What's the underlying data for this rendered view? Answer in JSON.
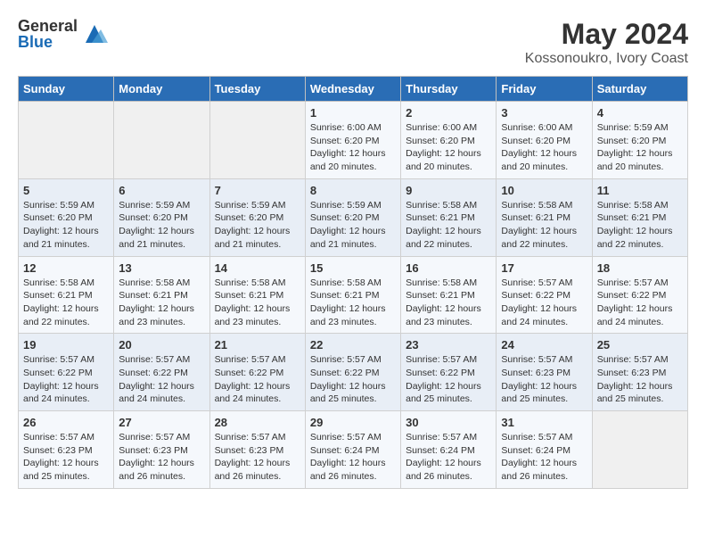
{
  "logo": {
    "general": "General",
    "blue": "Blue"
  },
  "title": "May 2024",
  "subtitle": "Kossonoukro, Ivory Coast",
  "days": [
    "Sunday",
    "Monday",
    "Tuesday",
    "Wednesday",
    "Thursday",
    "Friday",
    "Saturday"
  ],
  "weeks": [
    [
      {
        "day": "",
        "content": ""
      },
      {
        "day": "",
        "content": ""
      },
      {
        "day": "",
        "content": ""
      },
      {
        "day": "1",
        "content": "Sunrise: 6:00 AM\nSunset: 6:20 PM\nDaylight: 12 hours\nand 20 minutes."
      },
      {
        "day": "2",
        "content": "Sunrise: 6:00 AM\nSunset: 6:20 PM\nDaylight: 12 hours\nand 20 minutes."
      },
      {
        "day": "3",
        "content": "Sunrise: 6:00 AM\nSunset: 6:20 PM\nDaylight: 12 hours\nand 20 minutes."
      },
      {
        "day": "4",
        "content": "Sunrise: 5:59 AM\nSunset: 6:20 PM\nDaylight: 12 hours\nand 20 minutes."
      }
    ],
    [
      {
        "day": "5",
        "content": "Sunrise: 5:59 AM\nSunset: 6:20 PM\nDaylight: 12 hours\nand 21 minutes."
      },
      {
        "day": "6",
        "content": "Sunrise: 5:59 AM\nSunset: 6:20 PM\nDaylight: 12 hours\nand 21 minutes."
      },
      {
        "day": "7",
        "content": "Sunrise: 5:59 AM\nSunset: 6:20 PM\nDaylight: 12 hours\nand 21 minutes."
      },
      {
        "day": "8",
        "content": "Sunrise: 5:59 AM\nSunset: 6:20 PM\nDaylight: 12 hours\nand 21 minutes."
      },
      {
        "day": "9",
        "content": "Sunrise: 5:58 AM\nSunset: 6:21 PM\nDaylight: 12 hours\nand 22 minutes."
      },
      {
        "day": "10",
        "content": "Sunrise: 5:58 AM\nSunset: 6:21 PM\nDaylight: 12 hours\nand 22 minutes."
      },
      {
        "day": "11",
        "content": "Sunrise: 5:58 AM\nSunset: 6:21 PM\nDaylight: 12 hours\nand 22 minutes."
      }
    ],
    [
      {
        "day": "12",
        "content": "Sunrise: 5:58 AM\nSunset: 6:21 PM\nDaylight: 12 hours\nand 22 minutes."
      },
      {
        "day": "13",
        "content": "Sunrise: 5:58 AM\nSunset: 6:21 PM\nDaylight: 12 hours\nand 23 minutes."
      },
      {
        "day": "14",
        "content": "Sunrise: 5:58 AM\nSunset: 6:21 PM\nDaylight: 12 hours\nand 23 minutes."
      },
      {
        "day": "15",
        "content": "Sunrise: 5:58 AM\nSunset: 6:21 PM\nDaylight: 12 hours\nand 23 minutes."
      },
      {
        "day": "16",
        "content": "Sunrise: 5:58 AM\nSunset: 6:21 PM\nDaylight: 12 hours\nand 23 minutes."
      },
      {
        "day": "17",
        "content": "Sunrise: 5:57 AM\nSunset: 6:22 PM\nDaylight: 12 hours\nand 24 minutes."
      },
      {
        "day": "18",
        "content": "Sunrise: 5:57 AM\nSunset: 6:22 PM\nDaylight: 12 hours\nand 24 minutes."
      }
    ],
    [
      {
        "day": "19",
        "content": "Sunrise: 5:57 AM\nSunset: 6:22 PM\nDaylight: 12 hours\nand 24 minutes."
      },
      {
        "day": "20",
        "content": "Sunrise: 5:57 AM\nSunset: 6:22 PM\nDaylight: 12 hours\nand 24 minutes."
      },
      {
        "day": "21",
        "content": "Sunrise: 5:57 AM\nSunset: 6:22 PM\nDaylight: 12 hours\nand 24 minutes."
      },
      {
        "day": "22",
        "content": "Sunrise: 5:57 AM\nSunset: 6:22 PM\nDaylight: 12 hours\nand 25 minutes."
      },
      {
        "day": "23",
        "content": "Sunrise: 5:57 AM\nSunset: 6:22 PM\nDaylight: 12 hours\nand 25 minutes."
      },
      {
        "day": "24",
        "content": "Sunrise: 5:57 AM\nSunset: 6:23 PM\nDaylight: 12 hours\nand 25 minutes."
      },
      {
        "day": "25",
        "content": "Sunrise: 5:57 AM\nSunset: 6:23 PM\nDaylight: 12 hours\nand 25 minutes."
      }
    ],
    [
      {
        "day": "26",
        "content": "Sunrise: 5:57 AM\nSunset: 6:23 PM\nDaylight: 12 hours\nand 25 minutes."
      },
      {
        "day": "27",
        "content": "Sunrise: 5:57 AM\nSunset: 6:23 PM\nDaylight: 12 hours\nand 26 minutes."
      },
      {
        "day": "28",
        "content": "Sunrise: 5:57 AM\nSunset: 6:23 PM\nDaylight: 12 hours\nand 26 minutes."
      },
      {
        "day": "29",
        "content": "Sunrise: 5:57 AM\nSunset: 6:24 PM\nDaylight: 12 hours\nand 26 minutes."
      },
      {
        "day": "30",
        "content": "Sunrise: 5:57 AM\nSunset: 6:24 PM\nDaylight: 12 hours\nand 26 minutes."
      },
      {
        "day": "31",
        "content": "Sunrise: 5:57 AM\nSunset: 6:24 PM\nDaylight: 12 hours\nand 26 minutes."
      },
      {
        "day": "",
        "content": ""
      }
    ]
  ]
}
